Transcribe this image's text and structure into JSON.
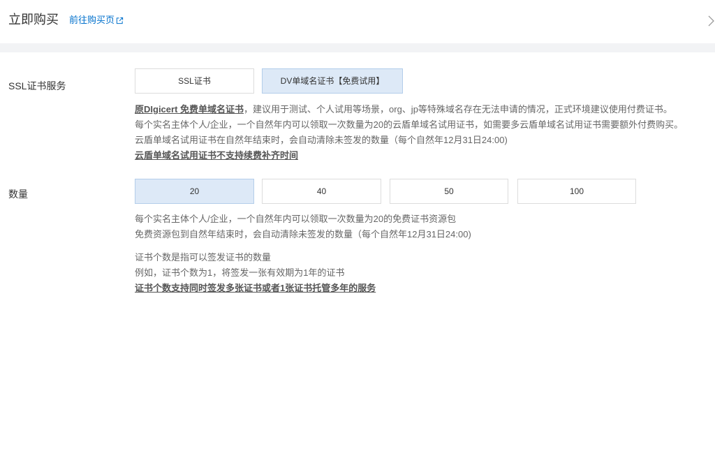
{
  "header": {
    "title": "立即购买",
    "link_label": "前往购买页",
    "link_icon": "external-link-icon",
    "collapse_icon": "chevron-right-icon"
  },
  "ssl_service": {
    "label": "SSL证书服务",
    "selected_index": 1,
    "options": [
      {
        "label": "SSL证书"
      },
      {
        "label": "DV单域名证书【免费试用】"
      }
    ],
    "desc": {
      "line1_emphasis": "原DIgicert 免费单域名证书",
      "line1_rest": "，建议用于测试、个人试用等场景，org、jp等特殊域名存在无法申请的情况，正式环境建议使用付费证书。",
      "line2": "每个实名主体个人/企业，一个自然年内可以领取一次数量为20的云盾单域名试用证书，如需要多云盾单域名试用证书需要额外付费购买。",
      "line3": "云盾单域名试用证书在自然年结束时，会自动清除未签发的数量（每个自然年12月31日24:00)",
      "line4_emphasis": "云盾单域名试用证书不支持续费补齐时间"
    }
  },
  "quantity": {
    "label": "数量",
    "selected_index": 0,
    "options": [
      {
        "label": "20"
      },
      {
        "label": "40"
      },
      {
        "label": "50"
      },
      {
        "label": "100"
      }
    ],
    "notes": {
      "line1": "每个实名主体个人/企业，一个自然年内可以领取一次数量为20的免费证书资源包",
      "line2": "免费资源包到自然年结束时，会自动清除未签发的数量（每个自然年12月31日24:00)",
      "line3": "证书个数是指可以签发证书的数量",
      "line4": "例如，证书个数为1，将签发一张有效期为1年的证书",
      "line5_emphasis": "证书个数支持同时签发多张证书或者1张证书托管多年的服务"
    }
  },
  "colors": {
    "link": "#0070cc",
    "selected_bg": "#dde9f7",
    "selected_border": "#b3cdea",
    "band": "#f2f3f5",
    "option_border": "#dcdcdc",
    "muted_text": "#666666",
    "strong_text": "#555555"
  }
}
